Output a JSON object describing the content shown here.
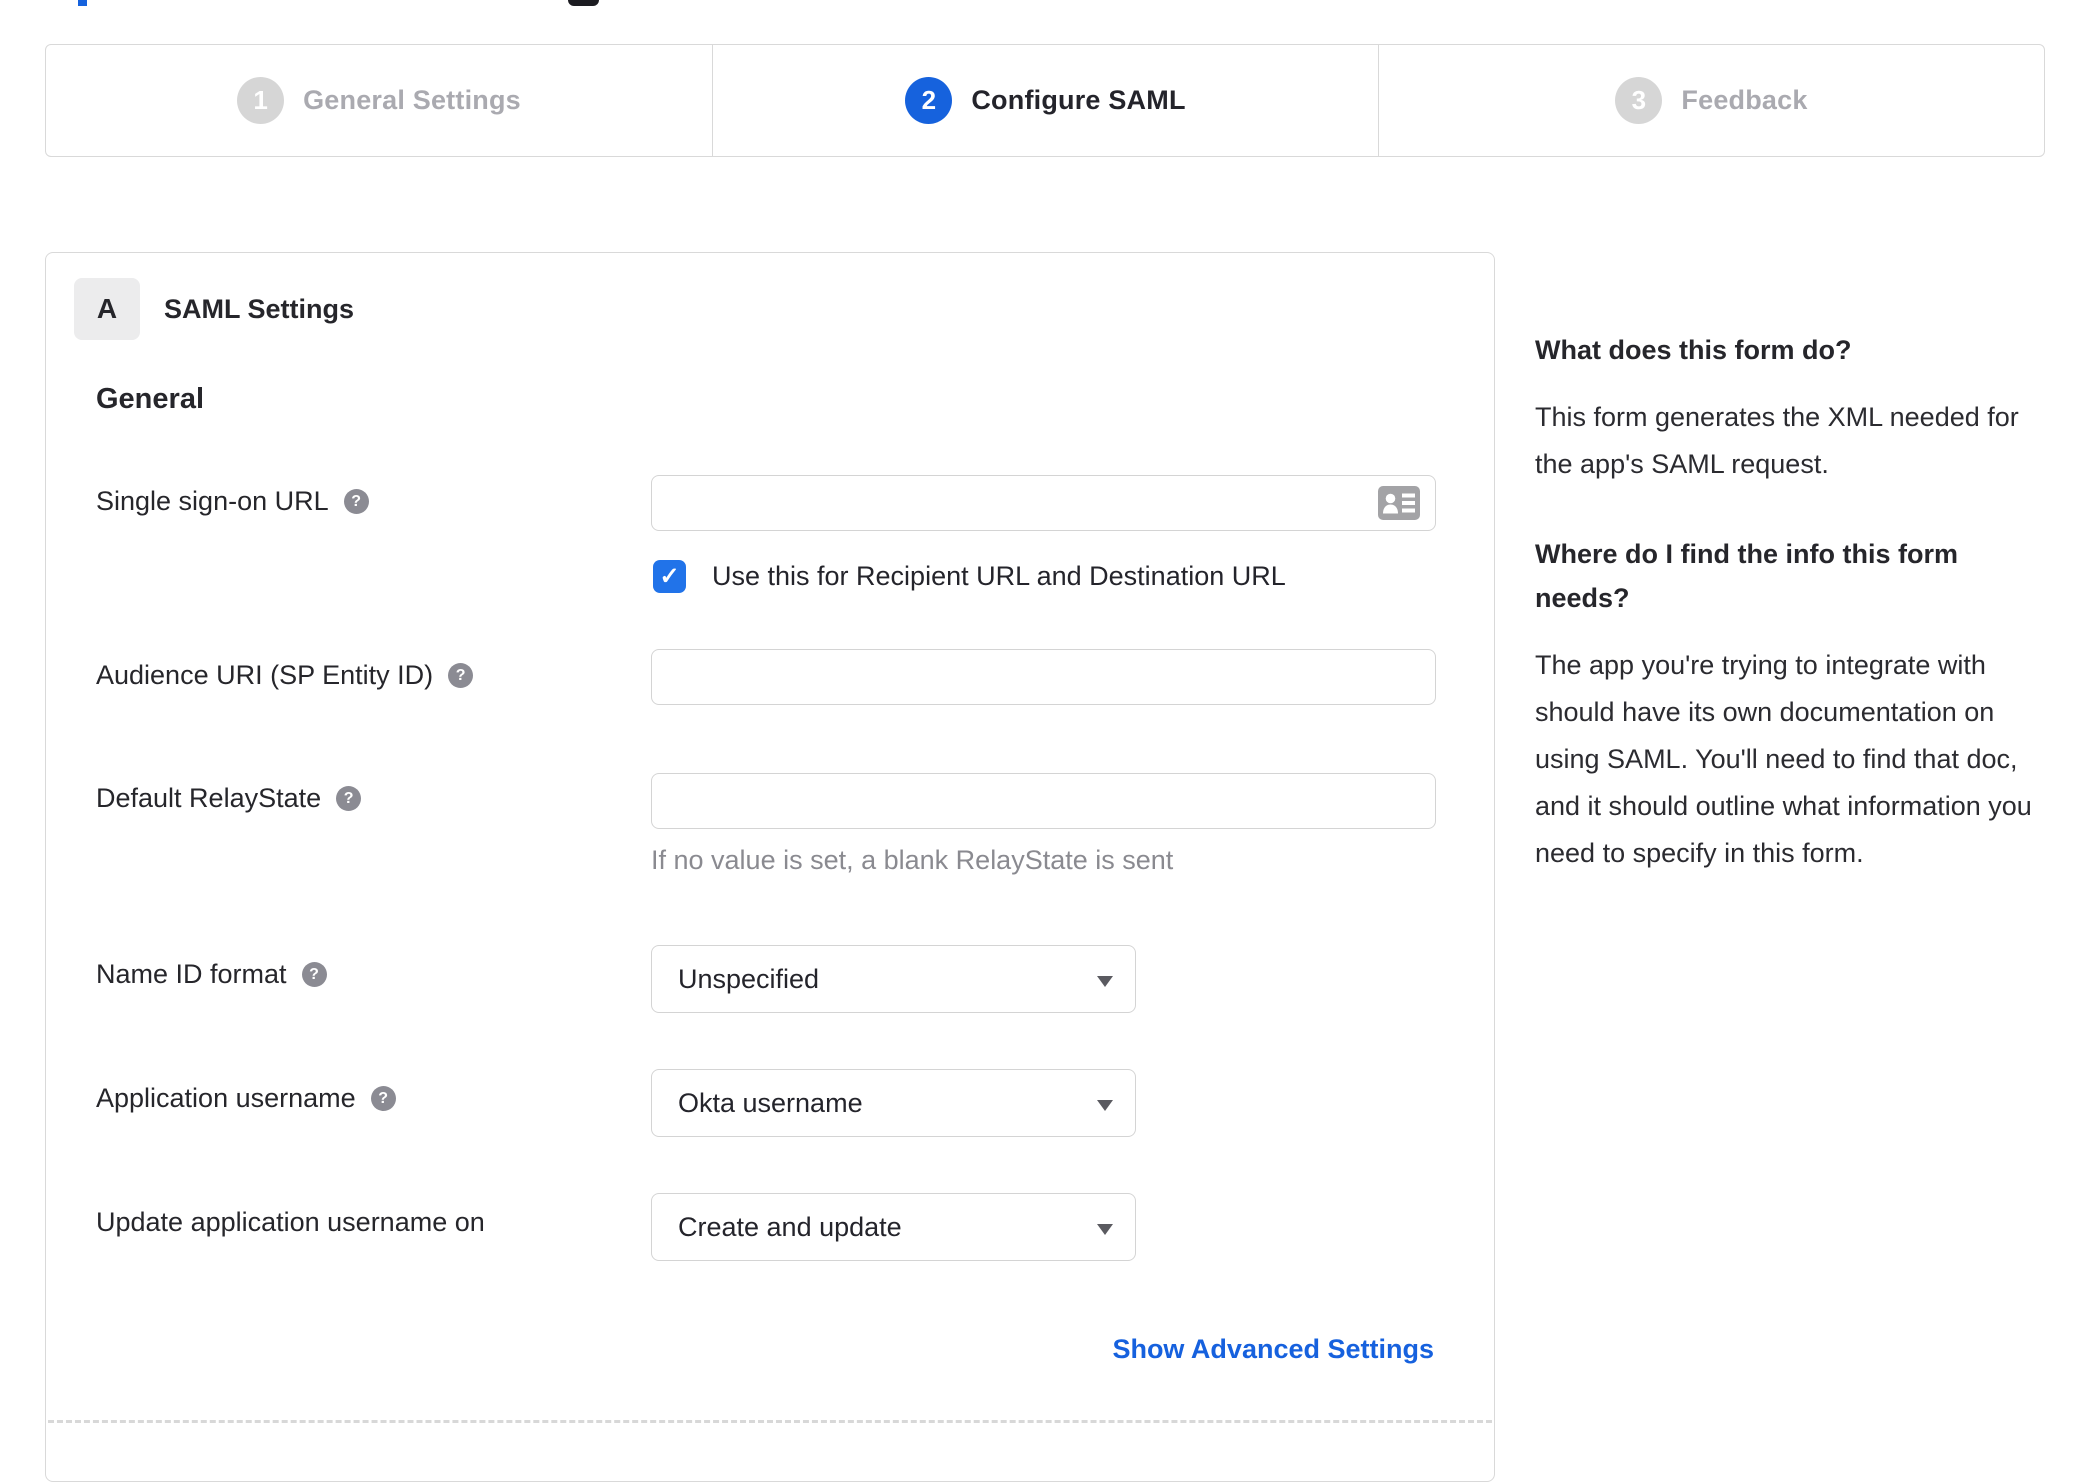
{
  "stepper": {
    "steps": [
      {
        "number": "1",
        "label": "General Settings",
        "state": "inactive"
      },
      {
        "number": "2",
        "label": "Configure SAML",
        "state": "active"
      },
      {
        "number": "3",
        "label": "Feedback",
        "state": "inactive"
      }
    ]
  },
  "panel": {
    "section_badge": "A",
    "section_title": "SAML Settings",
    "group_heading": "General",
    "fields": {
      "sso": {
        "label": "Single sign-on URL",
        "value": "",
        "checkbox_label": "Use this for Recipient URL and Destination URL",
        "checkbox_checked": true
      },
      "audience": {
        "label": "Audience URI (SP Entity ID)",
        "value": ""
      },
      "relay": {
        "label": "Default RelayState",
        "value": "",
        "hint": "If no value is set, a blank RelayState is sent"
      },
      "name_id": {
        "label": "Name ID format",
        "value": "Unspecified"
      },
      "app_username": {
        "label": "Application username",
        "value": "Okta username"
      },
      "update_username": {
        "label": "Update application username on",
        "value": "Create and update"
      }
    },
    "advanced_link": "Show Advanced Settings"
  },
  "help_sidebar": {
    "q1": "What does this form do?",
    "a1": "This form generates the XML needed for the app's SAML request.",
    "q2": "Where do I find the info this form needs?",
    "a2": "The app you're trying to integrate with should have its own documentation on using SAML. You'll need to find that doc, and it should outline what information you need to specify in this form."
  },
  "glyphs": {
    "question": "?",
    "check": "✓"
  },
  "colors": {
    "accent_blue": "#1662dd",
    "checkbox_blue": "#2173e9",
    "link_blue": "#1661de",
    "border_gray": "#d9d9d9",
    "inactive_gray": "#d6d6d6",
    "text_dark": "#26262b"
  }
}
